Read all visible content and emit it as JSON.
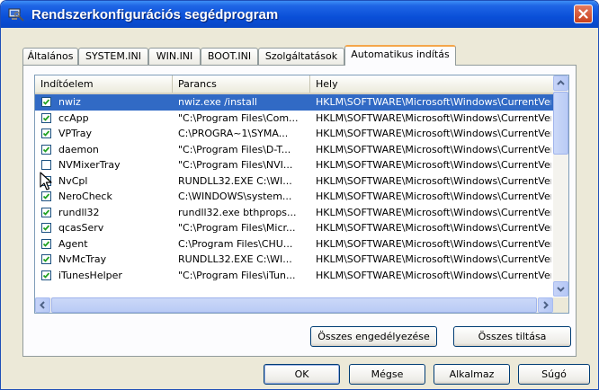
{
  "window": {
    "title": "Rendszerkonfigurációs segédprogram"
  },
  "tabs": [
    {
      "label": "Általános"
    },
    {
      "label": "SYSTEM.INI"
    },
    {
      "label": "WIN.INI"
    },
    {
      "label": "BOOT.INI"
    },
    {
      "label": "Szolgáltatások"
    },
    {
      "label": "Automatikus indítás"
    }
  ],
  "active_tab": "Automatikus indítás",
  "startup_list": {
    "columns": [
      "Indítóelem",
      "Parancs",
      "Hely"
    ],
    "rows": [
      {
        "item": "nwiz",
        "command": "nwiz.exe /install",
        "location": "HKLM\\SOFTWARE\\Microsoft\\Windows\\CurrentVer...",
        "checked": true,
        "selected": true
      },
      {
        "item": "ccApp",
        "command": "\"C:\\Program Files\\Com...",
        "location": "HKLM\\SOFTWARE\\Microsoft\\Windows\\CurrentVer...",
        "checked": true
      },
      {
        "item": "VPTray",
        "command": "C:\\PROGRA~1\\SYMA...",
        "location": "HKLM\\SOFTWARE\\Microsoft\\Windows\\CurrentVer...",
        "checked": true
      },
      {
        "item": "daemon",
        "command": "\"C:\\Program Files\\D-T...",
        "location": "HKLM\\SOFTWARE\\Microsoft\\Windows\\CurrentVer...",
        "checked": true
      },
      {
        "item": "NVMixerTray",
        "command": "\"C:\\Program Files\\NVI...",
        "location": "HKLM\\SOFTWARE\\Microsoft\\Windows\\CurrentVer...",
        "checked": false
      },
      {
        "item": "NvCpl",
        "command": "RUNDLL32.EXE C:\\WI...",
        "location": "HKLM\\SOFTWARE\\Microsoft\\Windows\\CurrentVer...",
        "checked": true
      },
      {
        "item": "NeroCheck",
        "command": "C:\\WINDOWS\\system...",
        "location": "HKLM\\SOFTWARE\\Microsoft\\Windows\\CurrentVer...",
        "checked": true
      },
      {
        "item": "rundll32",
        "command": "rundll32.exe bthprops...",
        "location": "HKLM\\SOFTWARE\\Microsoft\\Windows\\CurrentVer...",
        "checked": true
      },
      {
        "item": "qcasServ",
        "command": "\"C:\\Program Files\\Micr...",
        "location": "HKLM\\SOFTWARE\\Microsoft\\Windows\\CurrentVer...",
        "checked": true
      },
      {
        "item": "Agent",
        "command": "C:\\Program Files\\CHU...",
        "location": "HKLM\\SOFTWARE\\Microsoft\\Windows\\CurrentVer...",
        "checked": true
      },
      {
        "item": "NvMcTray",
        "command": "RUNDLL32.EXE C:\\WI...",
        "location": "HKLM\\SOFTWARE\\Microsoft\\Windows\\CurrentVer...",
        "checked": true
      },
      {
        "item": "iTunesHelper",
        "command": "\"C:\\Program Files\\iTun...",
        "location": "HKLM\\SOFTWARE\\Microsoft\\Windows\\CurrentVer...",
        "checked": true
      }
    ]
  },
  "panel_buttons": {
    "enable_all": "Összes engedélyezése",
    "disable_all": "Összes tiltása"
  },
  "dialog_buttons": {
    "ok": "OK",
    "cancel": "Mégse",
    "apply": "Alkalmaz",
    "help": "Súgó"
  },
  "colors": {
    "titlebar": "#0a4fd8",
    "selection": "#316ac5",
    "check": "#21a121",
    "tab_highlight": "#f5a64a"
  }
}
